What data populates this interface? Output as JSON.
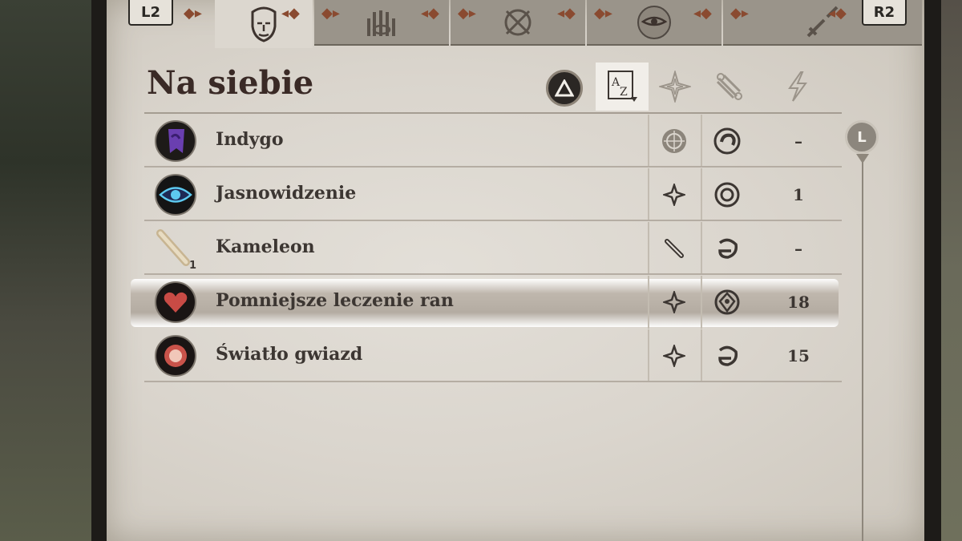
{
  "tabs": {
    "left_shoulder": "L2",
    "right_shoulder": "R2",
    "items": [
      {
        "icon": "face-icon",
        "active": true
      },
      {
        "icon": "hand-eye-icon",
        "active": false
      },
      {
        "icon": "knot-icon",
        "active": false
      },
      {
        "icon": "eye-of-ra-icon",
        "active": false
      },
      {
        "icon": "broken-sword-icon",
        "active": false
      }
    ]
  },
  "header": {
    "title": "Na siebie",
    "sort_button_icon": "triangle-icon",
    "sort_columns": [
      {
        "icon": "az-sort-icon",
        "active": true
      },
      {
        "icon": "compass-star-icon",
        "active": false
      },
      {
        "icon": "scroll-icon",
        "active": false
      },
      {
        "icon": "lightning-icon",
        "active": false
      }
    ]
  },
  "spells": [
    {
      "name": "Indygo",
      "icon": "purple-banner-icon",
      "type_icon": "rune-disc-icon",
      "school_icon": "swirl-icon",
      "cost": "–",
      "selected": false
    },
    {
      "name": "Jasnowidzenie",
      "icon": "eye-icon",
      "type_icon": "star-icon",
      "school_icon": "ring-icon",
      "cost": "1",
      "selected": false
    },
    {
      "name": "Kameleon",
      "icon": "scroll-icon",
      "badge": "1",
      "type_icon": "scroll-icon",
      "school_icon": "hook-icon",
      "cost": "–",
      "selected": false
    },
    {
      "name": "Pomniejsze leczenie ran",
      "icon": "heart-icon",
      "type_icon": "star-icon",
      "school_icon": "shield-eye-icon",
      "cost": "18",
      "selected": true
    },
    {
      "name": "Światło gwiazd",
      "icon": "red-orb-icon",
      "type_icon": "star-icon",
      "school_icon": "hook-icon",
      "cost": "15",
      "selected": false
    }
  ],
  "scrollbar": {
    "label": "L"
  },
  "colors": {
    "accent": "#8a4a30",
    "text": "#3c3632",
    "title": "#3a2a26",
    "parchment": "#dcd7cf"
  }
}
